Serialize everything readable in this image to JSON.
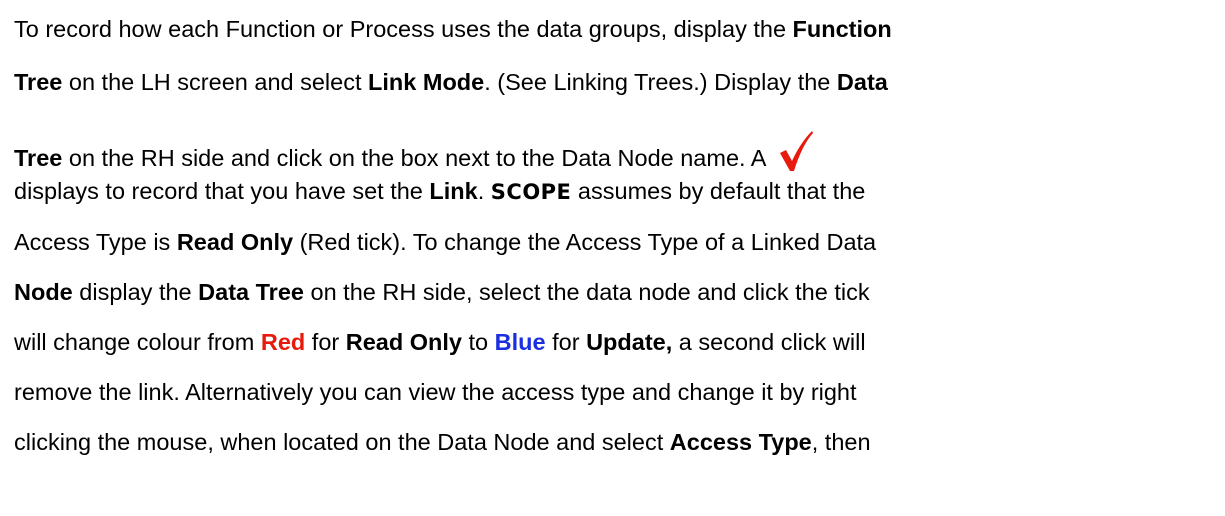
{
  "paragraph": {
    "l1": [
      "To record how each Function or Process uses the data groups, display the ",
      "Function"
    ],
    "l2": [
      "Tree",
      " on the LH screen and select ",
      "Link Mode",
      ". (See Linking Trees.)  Display the ",
      "Data"
    ],
    "l3": [
      "Tree",
      " on the RH side and click on the box next to the Data Node name.  A "
    ],
    "l4": [
      "displays to record that you have set the ",
      "Link",
      ".  ",
      "SCOPE",
      " assumes by default that the"
    ],
    "l5": [
      "Access Type is ",
      "Read Only",
      " (Red tick).  To change the Access Type of a Linked Data"
    ],
    "l6": [
      "Node",
      " display the ",
      "Data Tree",
      " on the RH side, select the data node and click the tick"
    ],
    "l7": [
      "will change colour from ",
      "Red",
      " for ",
      "Read Only",
      " to ",
      "Blue",
      " for ",
      "Update,",
      " a second click will"
    ],
    "l8": [
      "remove the link.  Alternatively you can view the access type and change it by right"
    ],
    "l9": [
      "clicking the mouse, when located on the Data Node and select ",
      "Access Type",
      ", then"
    ]
  },
  "icons": {
    "tick": "red-tick-icon",
    "tick_color": "#e8190d"
  },
  "colors": {
    "red": "#e8190d",
    "blue": "#1b2fe0"
  }
}
